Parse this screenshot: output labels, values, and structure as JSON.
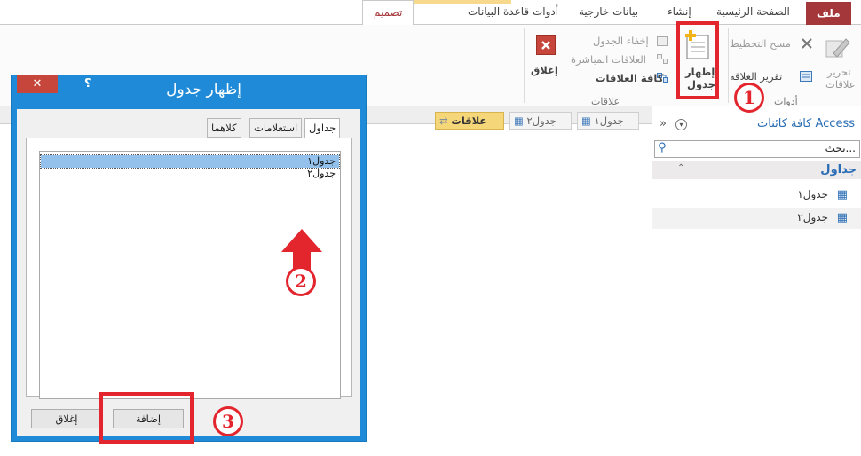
{
  "ribbon_tabs": {
    "file": "ملف",
    "home": "الصفحة الرئيسية",
    "create": "إنشاء",
    "external": "بيانات خارجية",
    "db_tools": "أدوات قاعدة البيانات",
    "design": "تصميم"
  },
  "ribbon": {
    "edit_relationships_1": "تحرير",
    "edit_relationships_2": "علاقات",
    "clear_layout": "مسح التخطيط",
    "relationship_report": "تقرير العلاقة",
    "tools_group": "أدوات",
    "show_table_1": "إظهار",
    "show_table_2": "جدول",
    "hide_table": "إخفاء الجدول",
    "direct_relationships": "العلاقات المباشرة",
    "all_relationships": "كافة العلاقات",
    "relationships_group": "علاقات",
    "close": "إغلاق"
  },
  "doc_tabs": [
    {
      "label": "علاقات"
    },
    {
      "label": "جدول٢"
    },
    {
      "label": "جدول١"
    }
  ],
  "nav": {
    "title": "كافة كائنات Access",
    "search_placeholder": "بحث...",
    "group": "جداول",
    "items": [
      {
        "label": "جدول١"
      },
      {
        "label": "جدول٢"
      }
    ],
    "collapse_glyph": "»"
  },
  "dialog": {
    "title": "إظهار جدول",
    "help": "؟",
    "close_glyph": "✕",
    "tabs": [
      "جداول",
      "استعلامات",
      "كلاهما"
    ],
    "list": [
      "جدول١",
      "جدول٢"
    ],
    "add_button": "إضافة",
    "close_button": "إغلاق"
  },
  "annotations": [
    "1",
    "2",
    "3"
  ],
  "colors": {
    "file_tab": "#a4373a",
    "dialog_frame": "#1f8ad7",
    "annotation_red": "#e3262e",
    "selection": "#93c1ec"
  }
}
